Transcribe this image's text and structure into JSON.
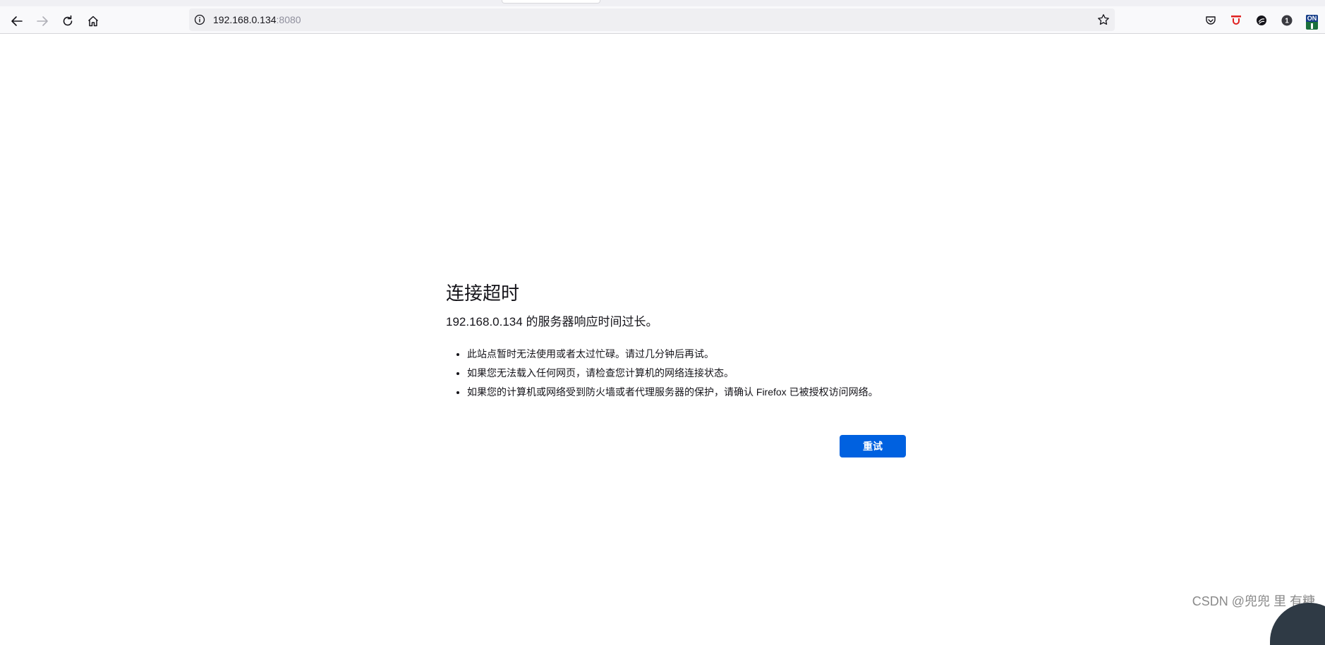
{
  "browser": {
    "url_host": "192.168.0.134",
    "url_port": ":8080",
    "toolbar_badge_count": "1",
    "extension_on_label": "ON"
  },
  "error_page": {
    "title": "连接超时",
    "description": "192.168.0.134 的服务器响应时间过长。",
    "suggestions": [
      "此站点暂时无法使用或者太过忙碌。请过几分钟后再试。",
      "如果您无法载入任何网页，请检查您计算机的网络连接状态。",
      "如果您的计算机或网络受到防火墙或者代理服务器的保护，请确认 Firefox 已被授权访问网络。"
    ],
    "retry_label": "重试"
  },
  "watermark": "CSDN @兜兜 里 有糖",
  "colors": {
    "accent": "#0061e0",
    "toolbar_bg": "#f9f9fb",
    "urlbar_bg": "#efeff2"
  },
  "icons": {
    "back": "back-arrow-icon",
    "forward": "forward-arrow-icon",
    "reload": "reload-icon",
    "home": "home-icon",
    "info": "info-icon",
    "bookmark": "star-icon",
    "pocket": "pocket-icon",
    "extension_red": "red-extension-icon",
    "extension_dark": "dark-circle-extension-icon",
    "badge": "notification-badge-icon",
    "on_extension": "on-extension-icon"
  }
}
